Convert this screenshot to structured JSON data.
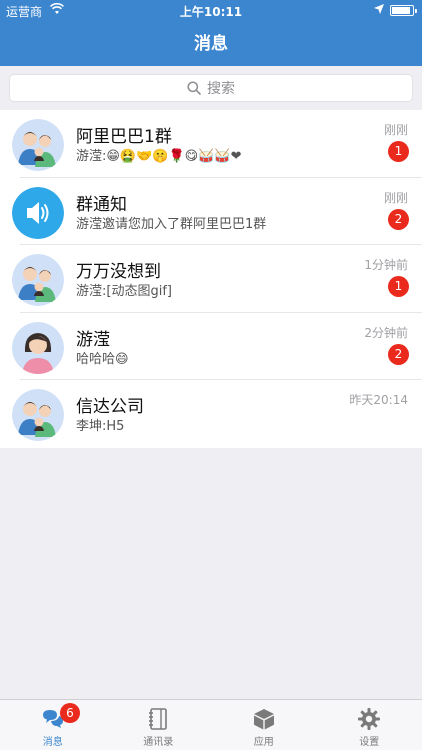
{
  "status_bar": {
    "carrier": "运营商",
    "time": "上午10:11"
  },
  "nav": {
    "title": "消息"
  },
  "search": {
    "placeholder": "搜索"
  },
  "conversations": [
    {
      "title": "阿里巴巴1群",
      "subtitle": "游滢:😁🤮🤝🤫🌹😋🥁🥁❤",
      "time": "刚刚",
      "badge": "1",
      "avatar": "group-avatar"
    },
    {
      "title": "群通知",
      "subtitle": "游滢邀请您加入了群阿里巴巴1群",
      "time": "刚刚",
      "badge": "2",
      "avatar": "speaker-icon"
    },
    {
      "title": "万万没想到",
      "subtitle": "游滢:[动态图gif]",
      "time": "1分钟前",
      "badge": "1",
      "avatar": "group-avatar"
    },
    {
      "title": "游滢",
      "subtitle": "哈哈哈😄",
      "time": "2分钟前",
      "badge": "2",
      "avatar": "person-avatar"
    },
    {
      "title": "信达公司",
      "subtitle": "李坤:H5",
      "time": "昨天20:14",
      "badge": "",
      "avatar": "group-avatar"
    }
  ],
  "tabbar": {
    "items": [
      {
        "label": "消息",
        "icon": "chat-icon",
        "badge": "6",
        "active": true
      },
      {
        "label": "通讯录",
        "icon": "contacts-icon",
        "badge": "",
        "active": false
      },
      {
        "label": "应用",
        "icon": "box-icon",
        "badge": "",
        "active": false
      },
      {
        "label": "设置",
        "icon": "gear-icon",
        "badge": "",
        "active": false
      }
    ]
  },
  "colors": {
    "primary": "#3c86cf",
    "badge": "#ea2a1d",
    "background": "#eeeef3"
  }
}
